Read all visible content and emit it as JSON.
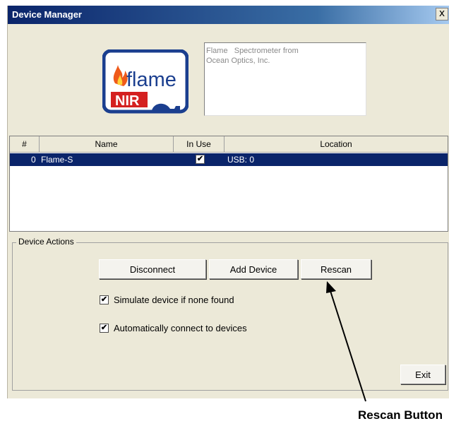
{
  "window": {
    "title": "Device Manager",
    "close_symbol": "x"
  },
  "logo": {
    "icon_name": "flame-nir-logo",
    "brand_text": "flame",
    "sub_text": "NIR",
    "colors": {
      "frame": "#1b3f8f",
      "sub_bg": "#d42020",
      "flame": "#ef5a1a"
    }
  },
  "description": "Flame   Spectrometer from\nOcean Optics, Inc.",
  "device_table": {
    "columns": [
      "#",
      "Name",
      "In Use",
      "Location"
    ],
    "rows": [
      {
        "index": "0",
        "name": "Flame-S",
        "in_use": true,
        "in_use_mark": "✔",
        "location": "USB: 0"
      }
    ],
    "selection_color": "#0a246a"
  },
  "device_actions": {
    "label": "Device Actions",
    "disconnect_label": "Disconnect",
    "add_device_label": "Add Device",
    "rescan_label": "Rescan",
    "simulate_label": "Simulate device if none found",
    "simulate_checked": true,
    "auto_connect_label": "Automatically connect to devices",
    "auto_connect_checked": true,
    "check_mark": "✔"
  },
  "exit_label": "Exit",
  "annotation": {
    "text": "Rescan Button"
  }
}
